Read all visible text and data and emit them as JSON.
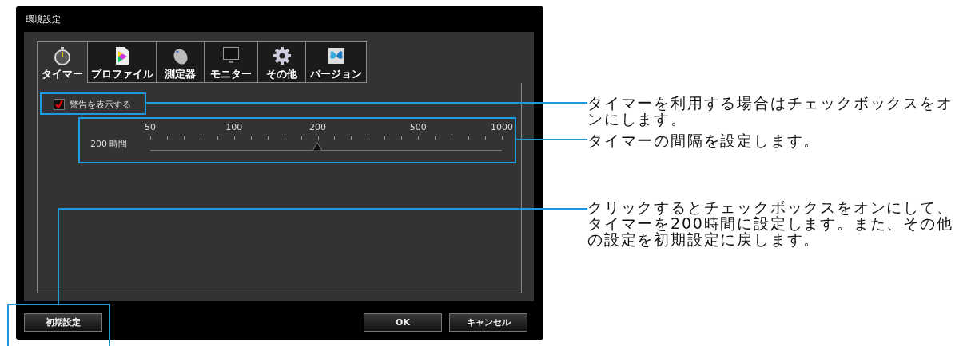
{
  "window": {
    "title": "環境設定"
  },
  "tabs": [
    {
      "label": "タイマー",
      "selected": true
    },
    {
      "label": "プロファイル",
      "selected": false
    },
    {
      "label": "測定器",
      "selected": false
    },
    {
      "label": "モニター",
      "selected": false
    },
    {
      "label": "その他",
      "selected": false
    },
    {
      "label": "バージョン",
      "selected": false
    }
  ],
  "warning_checkbox": {
    "label": "警告を表示する",
    "checked": true
  },
  "interval_slider": {
    "reading": "200 時間",
    "level": 0.476,
    "tick_labels": [
      "50",
      "100",
      "200",
      "500",
      "1000"
    ]
  },
  "buttons": {
    "reset": "初期設定",
    "ok": "OK",
    "cancel": "キャンセル"
  },
  "annotations": [
    {
      "lines": [
        "タイマーを利用する場合はチェックボックスをオ",
        "ンにします。"
      ]
    },
    {
      "lines": [
        "タイマーの間隔を設定します。"
      ]
    },
    {
      "lines": [
        "クリックするとチェックボックスをオンにして、",
        "タイマーを200時間に設定します。また、その他",
        "の設定を初期設定に戻します。"
      ]
    }
  ]
}
